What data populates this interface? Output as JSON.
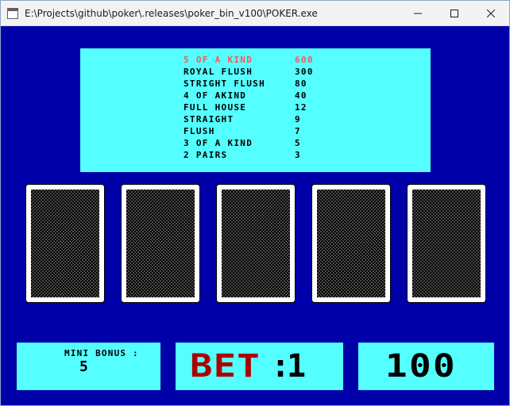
{
  "window": {
    "title": "E:\\Projects\\github\\poker\\.releases\\poker_bin_v100\\POKER.exe"
  },
  "paytable": {
    "rows": [
      {
        "hand": "5 OF A KIND",
        "payout": "600"
      },
      {
        "hand": "ROYAL FLUSH",
        "payout": "300"
      },
      {
        "hand": "STRIGHT FLUSH",
        "payout": "80"
      },
      {
        "hand": "4 OF AKIND",
        "payout": "40"
      },
      {
        "hand": "FULL HOUSE",
        "payout": "12"
      },
      {
        "hand": "STRAIGHT",
        "payout": "9"
      },
      {
        "hand": "FLUSH",
        "payout": "7"
      },
      {
        "hand": "3 OF A KIND",
        "payout": "5"
      },
      {
        "hand": "2 PAIRS",
        "payout": "3"
      }
    ],
    "highlight_color": "#ff5555"
  },
  "cards": {
    "count": 5,
    "state": "face-down"
  },
  "bonus": {
    "label": "MINI BONUS :",
    "value": "5"
  },
  "bet": {
    "label": "BET",
    "colon": ":",
    "value": "1"
  },
  "credits": {
    "value": "100"
  },
  "colors": {
    "background": "#0000a8",
    "panel": "#55ffff",
    "bet_label": "#aa0000"
  }
}
